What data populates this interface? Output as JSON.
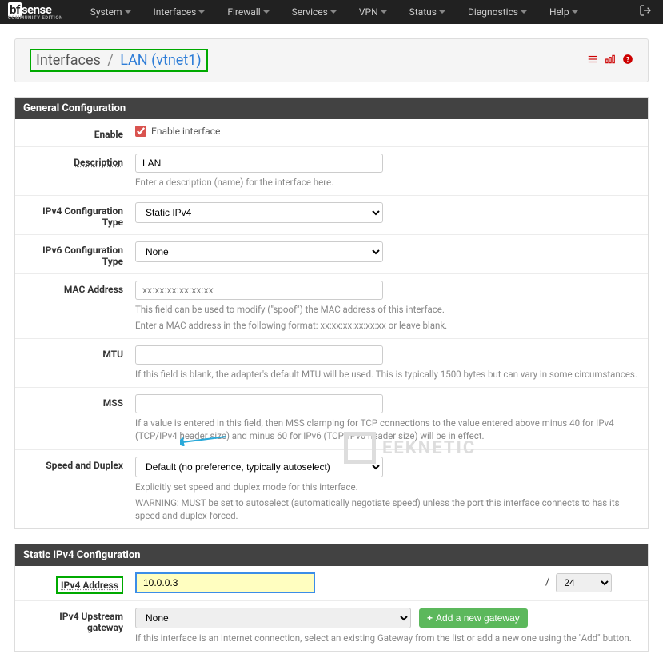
{
  "brand": {
    "main1": "bf",
    "main2": "sense",
    "sub": "COMMUNITY EDITION"
  },
  "nav": [
    "System",
    "Interfaces",
    "Firewall",
    "Services",
    "VPN",
    "Status",
    "Diagnostics",
    "Help"
  ],
  "header": {
    "crumb1": "Interfaces",
    "sep": "/",
    "crumb2": "LAN (vtnet1)"
  },
  "panels": {
    "general": {
      "title": "General Configuration",
      "enable": {
        "label": "Enable",
        "checkbox_label": "Enable interface",
        "checked": true
      },
      "description": {
        "label": "Description",
        "value": "LAN",
        "help": "Enter a description (name) for the interface here."
      },
      "ipv4type": {
        "label": "IPv4 Configuration Type",
        "value": "Static IPv4"
      },
      "ipv6type": {
        "label": "IPv6 Configuration Type",
        "value": "None"
      },
      "mac": {
        "label": "MAC Address",
        "placeholder": "xx:xx:xx:xx:xx:xx",
        "help1": "This field can be used to modify (\"spoof\") the MAC address of this interface.",
        "help2": "Enter a MAC address in the following format: xx:xx:xx:xx:xx:xx or leave blank."
      },
      "mtu": {
        "label": "MTU",
        "help": "If this field is blank, the adapter's default MTU will be used. This is typically 1500 bytes but can vary in some circumstances."
      },
      "mss": {
        "label": "MSS",
        "help": "If a value is entered in this field, then MSS clamping for TCP connections to the value entered above minus 40 for IPv4 (TCP/IPv4 header size) and minus 60 for IPv6 (TCP/IPv6 header size) will be in effect."
      },
      "speed": {
        "label": "Speed and Duplex",
        "value": "Default (no preference, typically autoselect)",
        "help1": "Explicitly set speed and duplex mode for this interface.",
        "help2": "WARNING: MUST be set to autoselect (automatically negotiate speed) unless the port this interface connects to has its speed and duplex forced."
      }
    },
    "static": {
      "title": "Static IPv4 Configuration",
      "ipv4addr": {
        "label": "IPv4 Address",
        "value": "10.0.0.3",
        "slash": "/",
        "cidr": "24"
      },
      "gateway": {
        "label": "IPv4 Upstream gateway",
        "value": "None",
        "btn": "Add a new gateway",
        "help": "If this interface is an Internet connection, select an existing Gateway from the list or add a new one using the \"Add\" button."
      }
    }
  },
  "watermark": "EEKNETIC"
}
